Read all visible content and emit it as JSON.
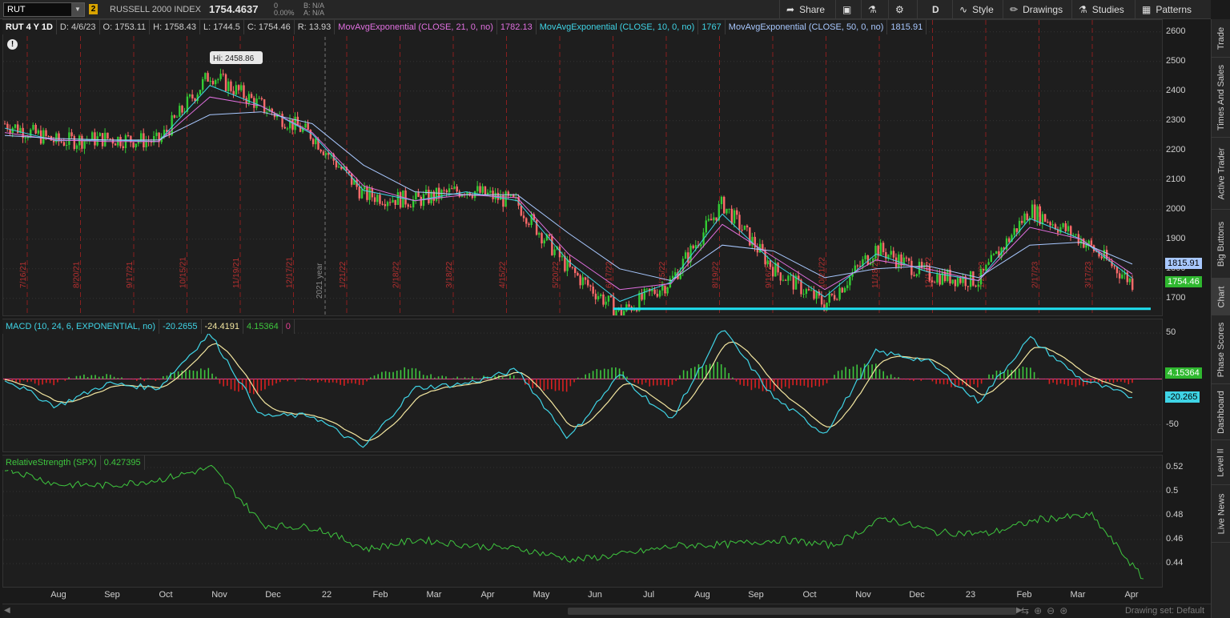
{
  "toolbar": {
    "symbol": "RUT",
    "link_number": "2",
    "index_name": "RUSSELL 2000 INDEX",
    "last_price": "1754.4637",
    "change": "0",
    "change_pct": "0.00%",
    "bid": "B: N/A",
    "ask": "A: N/A",
    "share_label": "Share",
    "timeframe_label": "D",
    "style_label": "Style",
    "drawings_label": "Drawings",
    "studies_label": "Studies",
    "patterns_label": "Patterns"
  },
  "side_tabs": [
    "Trade",
    "Times And Sales",
    "Active Trader",
    "Big Buttons",
    "Chart",
    "Phase Scores",
    "Dashboard",
    "Level II",
    "Live News"
  ],
  "price_panel": {
    "symbol_period": "RUT 4 Y 1D",
    "date": "D: 4/6/23",
    "open": "O: 1753.11",
    "high": "H: 1758.43",
    "low": "L: 1744.5",
    "close": "C: 1754.46",
    "range": "R: 13.93",
    "ema21_label": "MovAvgExponential (CLOSE, 21, 0, no)",
    "ema21_value": "1782.13",
    "ema10_label": "MovAvgExponential (CLOSE, 10, 0, no)",
    "ema10_value": "1767",
    "ema50_label": "MovAvgExponential (CLOSE, 50, 0, no)",
    "ema50_value": "1815.91",
    "high_callout": "Hi: 2458.86",
    "year_label": "2021 year",
    "axis_ticks": [
      "2600",
      "2500",
      "2400",
      "2300",
      "2200",
      "2100",
      "2000",
      "1900",
      "1800",
      "1700"
    ],
    "tag_ema50": "1815.91",
    "tag_last": "1754.46",
    "expiry_labels": [
      "7/16/21",
      "8/20/21",
      "9/17/21",
      "10/15/21",
      "11/19/21",
      "12/17/21",
      "1/21/22",
      "2/18/22",
      "3/18/22",
      "4/15/22",
      "5/20/22",
      "6/17/22",
      "7/15/22",
      "8/19/22",
      "9/16/22",
      "10/21/22",
      "11/18/22",
      "12/16/22",
      "1/20/23",
      "2/17/23",
      "3/17/23"
    ]
  },
  "macd_panel": {
    "label": "MACD (10, 24, 6, EXPONENTIAL, no)",
    "value": "-20.2655",
    "avg": "-24.4191",
    "diff": "4.15364",
    "zero": "0",
    "axis_ticks": [
      "50",
      "0",
      "-50"
    ],
    "tag_diff": "4.15364",
    "tag_value": "-20.265"
  },
  "rs_panel": {
    "label": "RelativeStrength (SPX)",
    "value": "0.427395",
    "axis_ticks": [
      "0.52",
      "0.5",
      "0.48",
      "0.46",
      "0.44"
    ]
  },
  "x_axis": [
    "Aug",
    "Sep",
    "Oct",
    "Nov",
    "Dec",
    "22",
    "Feb",
    "Mar",
    "Apr",
    "May",
    "Jun",
    "Jul",
    "Aug",
    "Sep",
    "Oct",
    "Nov",
    "Dec",
    "23",
    "Feb",
    "Mar",
    "Apr"
  ],
  "footer": {
    "drawing_set": "Drawing set: Default"
  },
  "chart_data": {
    "type": "line",
    "title": "RUT 4 Y 1D",
    "x": [
      "2021-07",
      "2021-08",
      "2021-09",
      "2021-10",
      "2021-11-08",
      "2021-11",
      "2021-12",
      "2022-01",
      "2022-02",
      "2022-03",
      "2022-04",
      "2022-05",
      "2022-06-16",
      "2022-07",
      "2022-08-16",
      "2022-09",
      "2022-10",
      "2022-11",
      "2022-12",
      "2023-01",
      "2023-02-02",
      "2023-03",
      "2023-04-06"
    ],
    "series": [
      {
        "name": "",
        "values": [
          2290,
          2230,
          2240,
          2230,
          2458,
          2350,
          2250,
          2050,
          2030,
          2070,
          2020,
          1800,
          1650,
          1760,
          2020,
          1800,
          1680,
          1870,
          1780,
          1760,
          2000,
          1900,
          1754
        ]
      },
      {
        "name": "MovAvgExponential (CLOSE, 21, 0, no)",
        "values": [
          2260,
          2235,
          2230,
          2230,
          2380,
          2350,
          2260,
          2080,
          2030,
          2050,
          2040,
          1850,
          1730,
          1750,
          1950,
          1840,
          1730,
          1830,
          1800,
          1760,
          1940,
          1900,
          1782
        ]
      },
      {
        "name": "MovAvgExponential (CLOSE, 50, 0, no)",
        "values": [
          2250,
          2240,
          2235,
          2235,
          2320,
          2330,
          2290,
          2150,
          2060,
          2050,
          2050,
          1920,
          1800,
          1760,
          1880,
          1860,
          1770,
          1800,
          1810,
          1770,
          1880,
          1890,
          1816
        ]
      }
    ],
    "support_level": 1665,
    "ylim": [
      1640,
      2640
    ],
    "macd": {
      "label": "MACD (10, 24, 6, EXPONENTIAL, no)",
      "values": [
        0,
        -30,
        -5,
        -10,
        50,
        -40,
        -40,
        -75,
        -10,
        -5,
        10,
        -65,
        5,
        -45,
        55,
        -20,
        -60,
        30,
        20,
        -25,
        45,
        0,
        -20
      ],
      "ylim": [
        -80,
        65
      ]
    },
    "relative_strength": {
      "label": "RelativeStrength (SPX)",
      "values": [
        0.52,
        0.506,
        0.505,
        0.51,
        0.52,
        0.472,
        0.47,
        0.452,
        0.46,
        0.455,
        0.452,
        0.443,
        0.448,
        0.455,
        0.456,
        0.46,
        0.455,
        0.478,
        0.466,
        0.465,
        0.477,
        0.48,
        0.427
      ],
      "ylim": [
        0.42,
        0.53
      ]
    },
    "grid": true,
    "legend": "top-left"
  }
}
